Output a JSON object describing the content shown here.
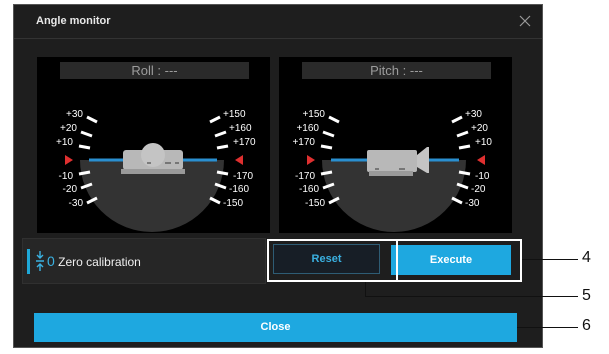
{
  "dialog": {
    "title": "Angle monitor"
  },
  "roll": {
    "label": "Roll : ---",
    "left_scale": [
      "+30",
      "+20",
      "+10",
      "-10",
      "-20",
      "-30"
    ],
    "right_scale": [
      "+150",
      "+160",
      "+170",
      "-170",
      "-160",
      "-150"
    ]
  },
  "pitch": {
    "label": "Pitch : ---",
    "left_scale": [
      "+150",
      "+160",
      "+170",
      "-170",
      "-160",
      "-150"
    ],
    "right_scale": [
      "+30",
      "+20",
      "+10",
      "-10",
      "-20",
      "-30"
    ]
  },
  "zero_calibration": {
    "icon_num": "0",
    "label": "Zero calibration"
  },
  "buttons": {
    "reset": "Reset",
    "execute": "Execute",
    "close": "Close"
  },
  "callouts": {
    "execute": "4",
    "reset": "5",
    "close": "6"
  },
  "colors": {
    "accent": "#1ea8e0",
    "horizon": "#2a8fd0",
    "marker": "#e03030"
  }
}
